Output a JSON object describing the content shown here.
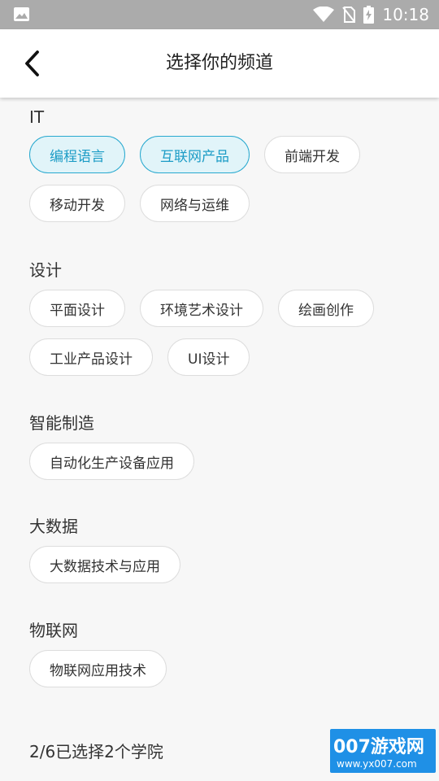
{
  "status_bar": {
    "time": "10:18"
  },
  "header": {
    "title": "选择你的频道"
  },
  "sections": [
    {
      "title": "IT",
      "chips": [
        {
          "label": "编程语言",
          "selected": true
        },
        {
          "label": "互联网产品",
          "selected": true
        },
        {
          "label": "前端开发",
          "selected": false
        },
        {
          "label": "移动开发",
          "selected": false
        },
        {
          "label": "网络与运维",
          "selected": false
        }
      ]
    },
    {
      "title": "设计",
      "chips": [
        {
          "label": "平面设计",
          "selected": false
        },
        {
          "label": "环境艺术设计",
          "selected": false
        },
        {
          "label": "绘画创作",
          "selected": false
        },
        {
          "label": "工业产品设计",
          "selected": false
        },
        {
          "label": "UI设计",
          "selected": false
        }
      ]
    },
    {
      "title": "智能制造",
      "chips": [
        {
          "label": "自动化生产设备应用",
          "selected": false
        }
      ]
    },
    {
      "title": "大数据",
      "chips": [
        {
          "label": "大数据技术与应用",
          "selected": false
        }
      ]
    },
    {
      "title": "物联网",
      "chips": [
        {
          "label": "物联网应用技术",
          "selected": false
        }
      ]
    }
  ],
  "footer": {
    "selection_text": "2/6已选择2个学院"
  },
  "watermark": {
    "main": "007游戏网",
    "sub": "www.yx007.com"
  },
  "colors": {
    "accent": "#1c9cc6",
    "selected_bg": "#e1f4f9",
    "status_bar": "#ababab"
  }
}
